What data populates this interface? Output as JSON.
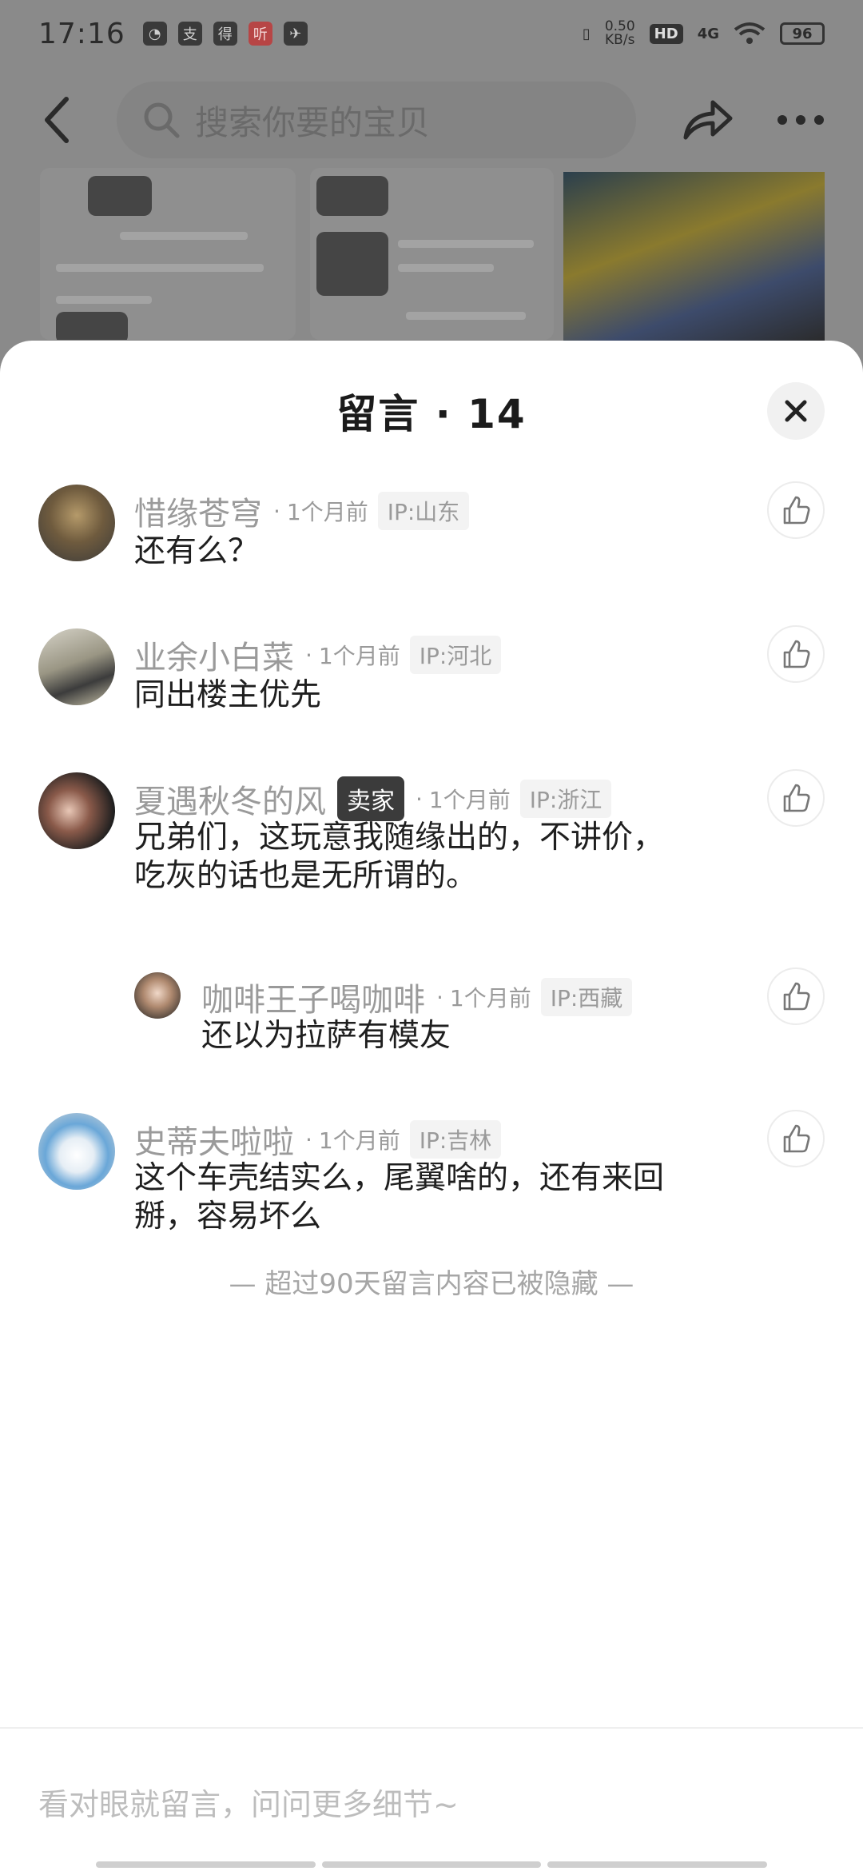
{
  "status_bar": {
    "time": "17:16",
    "app_icons": [
      "支",
      "得",
      "听"
    ],
    "net_speed_value": "0.50",
    "net_speed_unit": "KB/s",
    "hd": "HD",
    "network": "4G",
    "battery": "96"
  },
  "header": {
    "search_placeholder": "搜索你要的宝贝"
  },
  "sheet": {
    "title": "留言 · 14",
    "comments": [
      {
        "name": "惜缘苍穹",
        "time": "1个月前",
        "ip": "IP:山东",
        "text": "还有么？"
      },
      {
        "name": "业余小白菜",
        "time": "1个月前",
        "ip": "IP:河北",
        "text": "同出楼主优先"
      },
      {
        "name": "夏遇秋冬的风",
        "badge": "卖家",
        "time": "1个月前",
        "ip": "IP:浙江",
        "text_line1": "兄弟们，这玩意我随缘出的，不讲价，",
        "text_line2": "吃灰的话也是无所谓的。"
      },
      {
        "name": "咖啡王子喝咖啡",
        "time": "1个月前",
        "ip": "IP:西藏",
        "text": "还以为拉萨有模友"
      },
      {
        "name": "史蒂夫啦啦",
        "time": "1个月前",
        "ip": "IP:吉林",
        "text_line1": "这个车壳结实么，尾翼啥的，还有来回",
        "text_line2": "掰，容易坏么"
      }
    ],
    "hidden_note": "— 超过90天留言内容已被隐藏 —",
    "input_placeholder": "看对眼就留言，问问更多细节~"
  },
  "colors": {
    "overlay": "#8a8a8a",
    "seller_badge": "#3b3b3b",
    "meta_text": "#9a9a9a"
  }
}
